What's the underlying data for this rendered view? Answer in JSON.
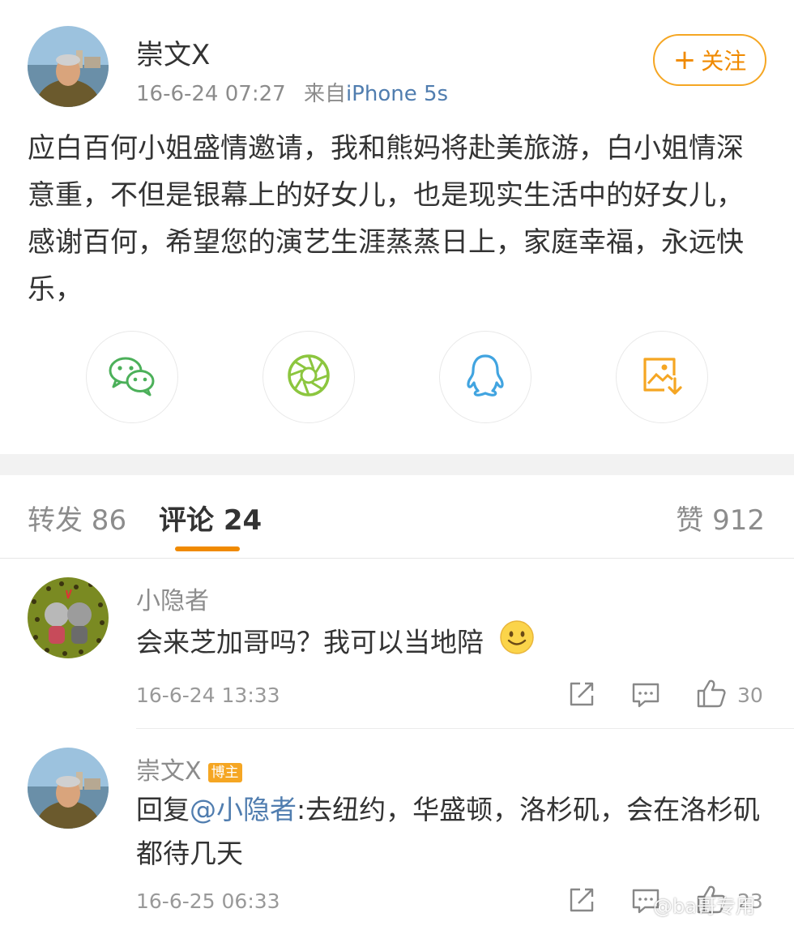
{
  "post": {
    "author": "崇文X",
    "time": "16-6-24 07:27",
    "source_prefix": "来自",
    "device": "iPhone 5s",
    "follow_label": "关注",
    "body": "应白百何小姐盛情邀请，我和熊妈将赴美旅游，白小姐情深意重，不但是银幕上的好女儿，也是现实生活中的好女儿，感谢百何，希望您的演艺生涯蒸蒸日上，家庭幸福，永远快乐，"
  },
  "share": {
    "icons": [
      "wechat-icon",
      "moments-icon",
      "qq-icon",
      "save-image-icon"
    ]
  },
  "tabs": {
    "repost": "转发 86",
    "comments": "评论 24",
    "likes": "赞 912"
  },
  "comments": [
    {
      "user": "小隐者",
      "text": "会来芝加哥吗？我可以当地陪",
      "time": "16-6-24 13:33",
      "likes": "30"
    },
    {
      "user": "崇文X",
      "badge": "博主",
      "reply_prefix": "回复",
      "mention": "@小隐者",
      "text": ":去纽约，华盛顿，洛杉矶，会在洛杉矶都待几天",
      "time": "16-6-25 06:33",
      "likes": "23"
    }
  ],
  "watermark": "@ba哥专用",
  "colors": {
    "accent": "#f08a00",
    "link": "#507daf",
    "muted": "#8c8c8c"
  }
}
